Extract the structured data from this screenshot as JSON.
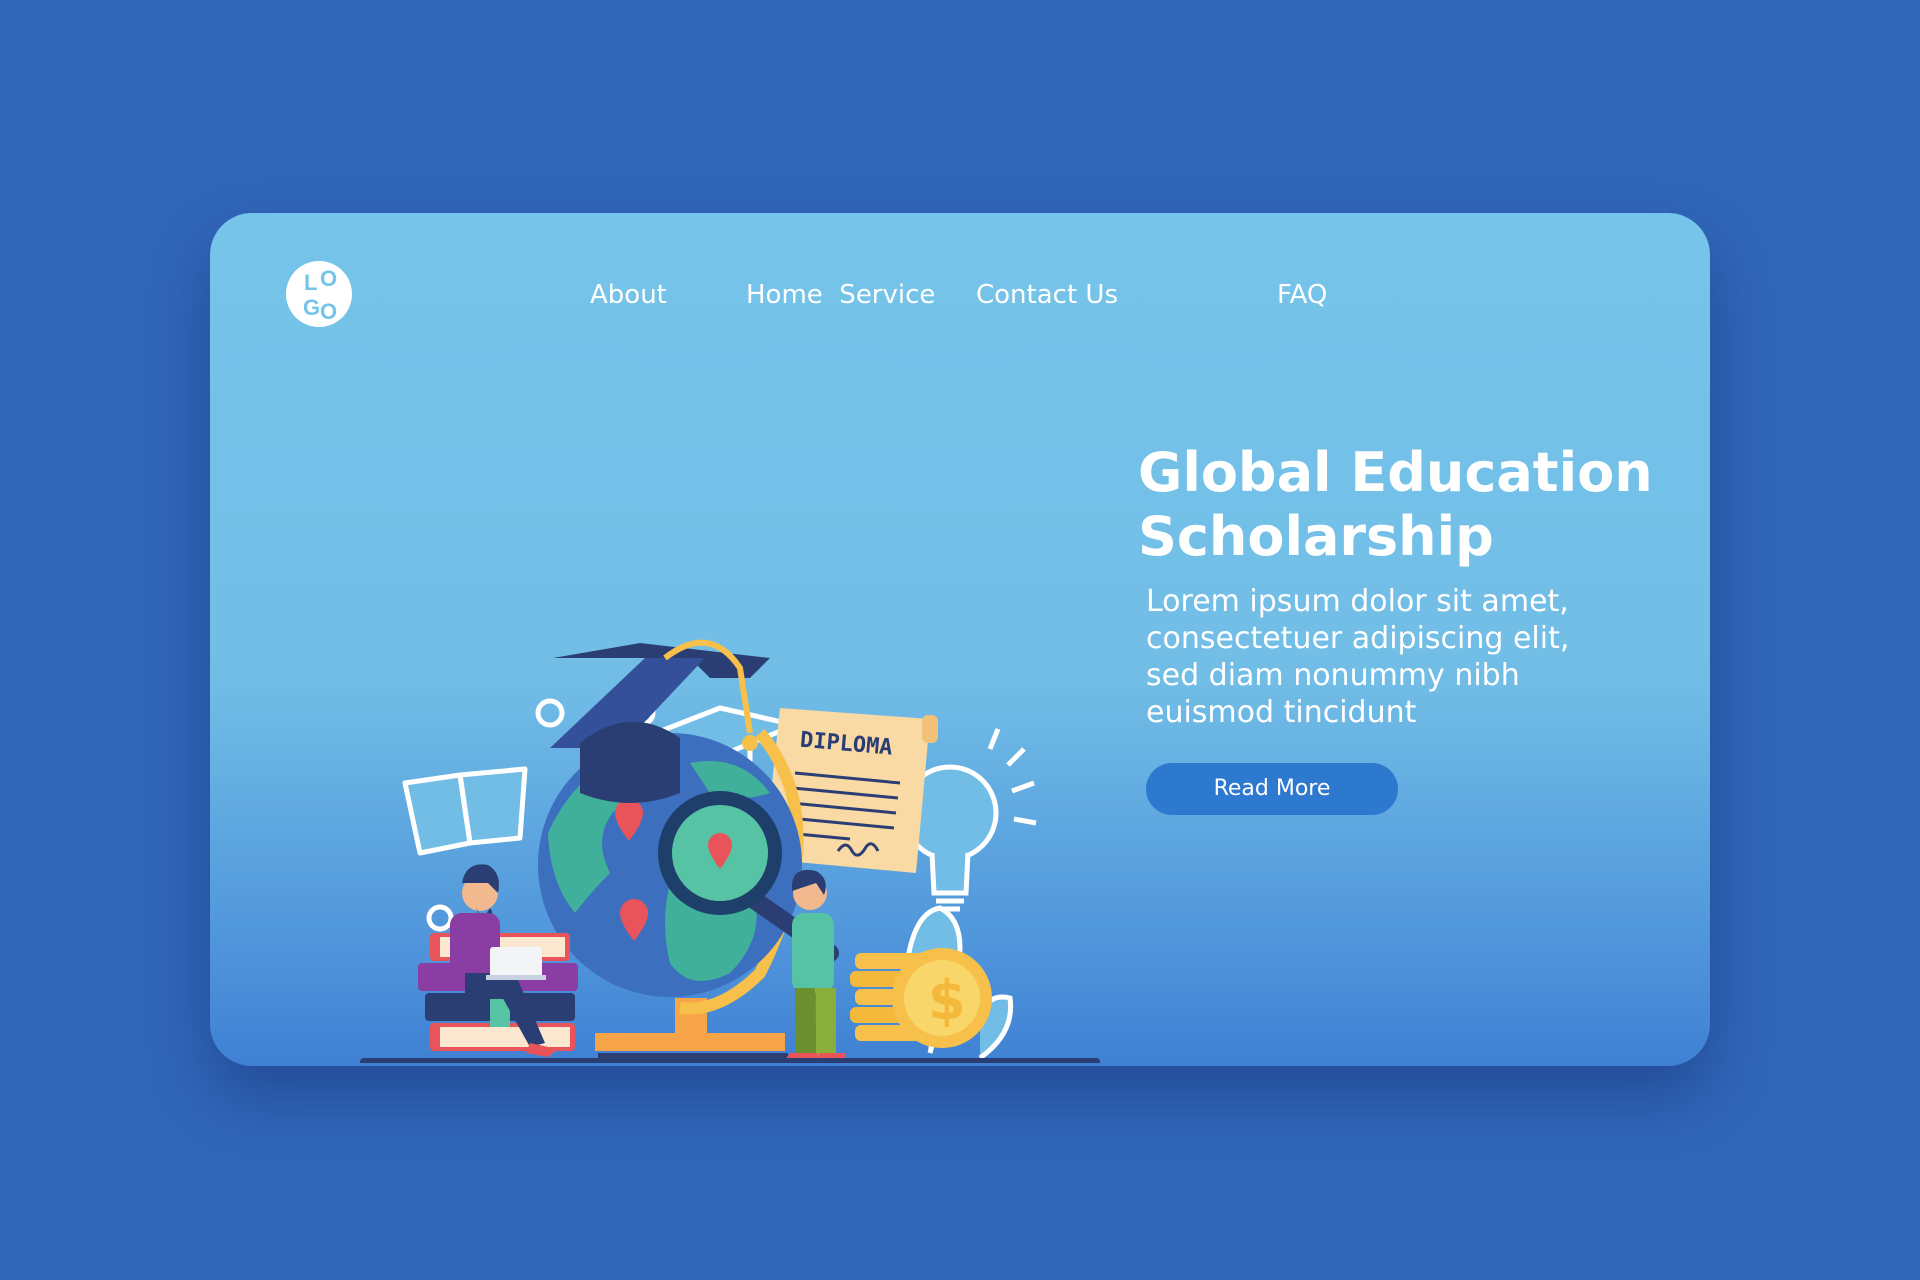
{
  "logo": {
    "letters": [
      "L",
      "O",
      "G",
      "O"
    ]
  },
  "nav": {
    "items": [
      {
        "label": "About"
      },
      {
        "label": "Home  Service"
      },
      {
        "label": "Contact Us"
      },
      {
        "label": "FAQ"
      }
    ]
  },
  "hero": {
    "title_line1": "Global Education",
    "title_line2": "Scholarship",
    "body": [
      "Lorem ipsum dolor sit amet,",
      "consectetuer adipiscing elit,",
      "sed diam nonummy nibh",
      "euismod tincidunt"
    ],
    "cta_label": "Read More"
  },
  "illustration": {
    "diploma_text": "DIPLOMA"
  },
  "colors": {
    "page_background": "#3166b9",
    "card_top": "#76c4ea",
    "card_bottom": "#3f80d3",
    "button": "#2d79cf",
    "text": "#ffffff"
  }
}
